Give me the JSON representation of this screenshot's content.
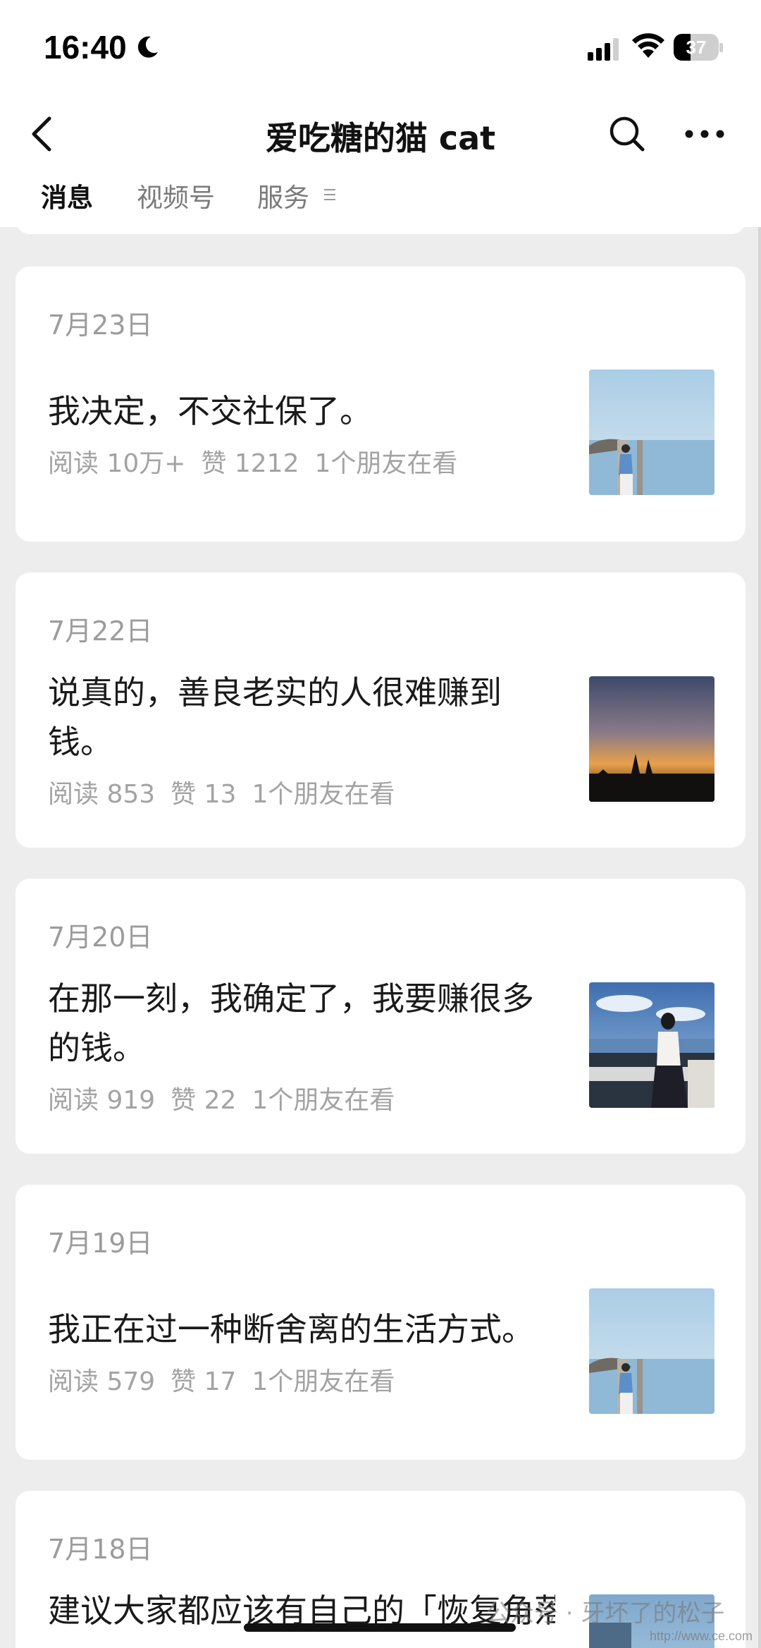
{
  "status_bar": {
    "time": "16:40",
    "battery": "37",
    "battery_level": 0.37
  },
  "nav": {
    "title": "爱吃糖的猫 cat"
  },
  "tabs": [
    {
      "label": "消息",
      "active": true
    },
    {
      "label": "视频号",
      "active": false
    },
    {
      "label": "服务",
      "active": false
    }
  ],
  "icons": {
    "back": "back-icon",
    "search": "search-icon",
    "more": "more-icon",
    "menu": "menu-icon"
  },
  "articles": [
    {
      "date": "7月23日",
      "title": "我决定，不交社保了。",
      "reads": "阅读 10万+",
      "likes": "赞 1212",
      "friends": "1个朋友在看",
      "thumb": "coast-woman"
    },
    {
      "date": "7月22日",
      "title": "说真的，善良老实的人很难赚到钱。",
      "reads": "阅读 853",
      "likes": "赞 13",
      "friends": "1个朋友在看",
      "thumb": "sunset"
    },
    {
      "date": "7月20日",
      "title": "在那一刻，我确定了，我要赚很多的钱。",
      "reads": "阅读 919",
      "likes": "赞 22",
      "friends": "1个朋友在看",
      "thumb": "harbor-woman"
    },
    {
      "date": "7月19日",
      "title": "我正在过一种断舍离的生活方式。",
      "reads": "阅读 579",
      "likes": "赞 17",
      "friends": "1个朋友在看",
      "thumb": "coast-woman"
    },
    {
      "date": "7月18日",
      "title": "建议大家都应该有自己的「恢复角落",
      "reads": "",
      "likes": "",
      "friends": "",
      "thumb": "coast-woman"
    }
  ],
  "watermark": "公众号 · 牙坏了的松子",
  "watermark_url": "http://www.ce.com"
}
